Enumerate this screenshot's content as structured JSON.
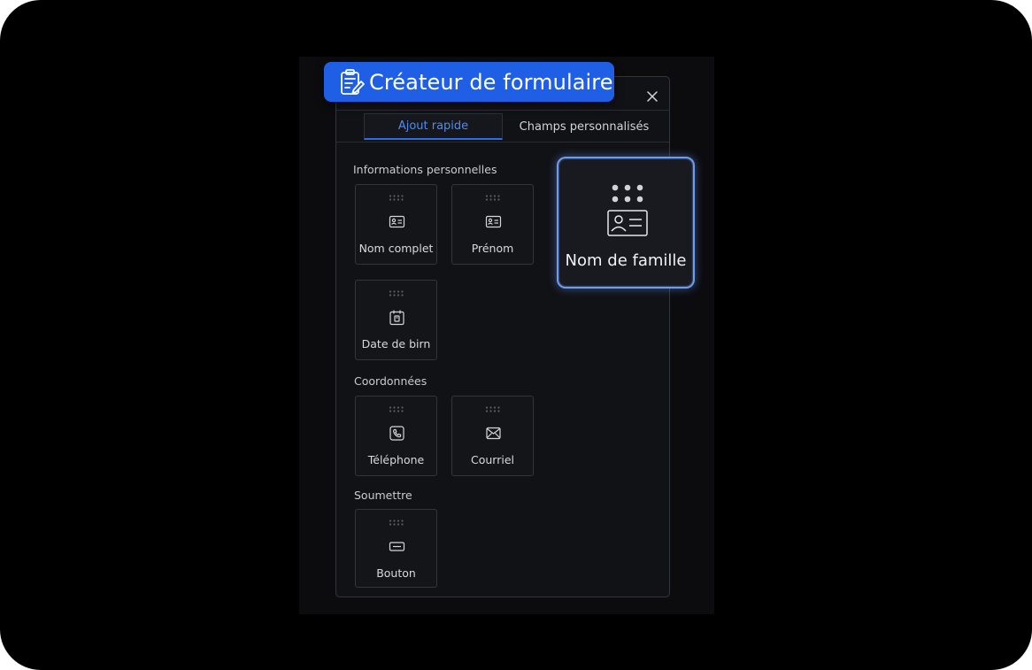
{
  "header": {
    "title": "Créateur de formulaire",
    "title_icon": "clipboard-edit-icon",
    "close_icon": "close-icon"
  },
  "tabs": [
    {
      "label": "Ajout rapide",
      "active": true
    },
    {
      "label": "Champs personnalisés",
      "active": false
    }
  ],
  "sections": {
    "personal": {
      "label": "Informations personnelles",
      "items": [
        {
          "label": "Nom complet",
          "icon": "id-card-icon"
        },
        {
          "label": "Prénom",
          "icon": "id-card-icon"
        },
        {
          "label": "Date de birn",
          "icon": "calendar-icon"
        }
      ]
    },
    "contact": {
      "label": "Coordonnées",
      "items": [
        {
          "label": "Téléphone",
          "icon": "phone-icon"
        },
        {
          "label": "Courriel",
          "icon": "mail-icon"
        }
      ]
    },
    "submit": {
      "label": "Soumettre",
      "items": [
        {
          "label": "Bouton",
          "icon": "button-icon"
        }
      ]
    }
  },
  "dragging_item": {
    "label": "Nom de famille",
    "icon": "id-card-icon"
  },
  "colors": {
    "accent": "#1f5fe6",
    "active_tab_text": "#4f8cf0",
    "drag_border": "#6e9bf2",
    "background": "#000000",
    "panel": "#111216"
  }
}
